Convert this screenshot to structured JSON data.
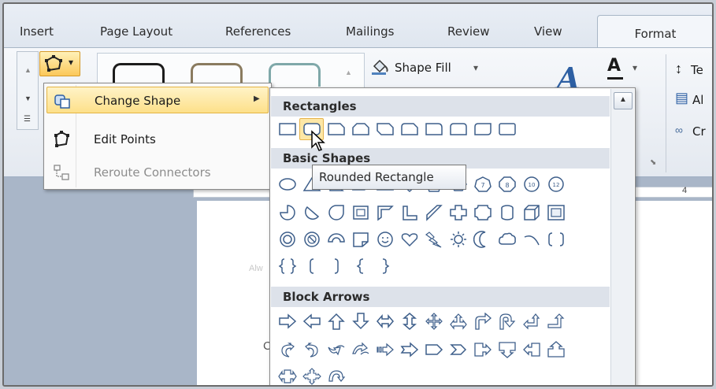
{
  "tabs": [
    {
      "label": "Insert"
    },
    {
      "label": "Page Layout"
    },
    {
      "label": "References"
    },
    {
      "label": "Mailings"
    },
    {
      "label": "Review"
    },
    {
      "label": "View"
    },
    {
      "label": "Format"
    }
  ],
  "ribbon": {
    "shape_fill_label": "Shape Fill",
    "dropdown_glyph": "▾",
    "partial_text_1": "Te",
    "partial_text_2": "Al",
    "partial_text_3": "Cr",
    "ruler_mark": "4"
  },
  "edit_menu": {
    "items": [
      {
        "label": "Change Shape",
        "underline_char": "n",
        "state": "highlighted"
      },
      {
        "label": "Edit Points",
        "state": "normal"
      },
      {
        "label": "Reroute Connectors",
        "state": "disabled"
      }
    ]
  },
  "gallery": {
    "sections": [
      {
        "title": "Rectangles"
      },
      {
        "title": "Basic Shapes"
      },
      {
        "title": "Block Arrows"
      }
    ],
    "hovered_shape": "Rounded Rectangle",
    "number_badges": [
      "7",
      "8",
      "10",
      "12"
    ]
  },
  "tooltip": {
    "text": "Rounded Rectangle"
  },
  "document": {
    "faint_text_1": "Alw",
    "faint_text_2": "C"
  },
  "colors": {
    "highlight": "#fde08a",
    "tab_active_bg": "#f3f6fa",
    "doc_bg": "#a9b6c8"
  }
}
